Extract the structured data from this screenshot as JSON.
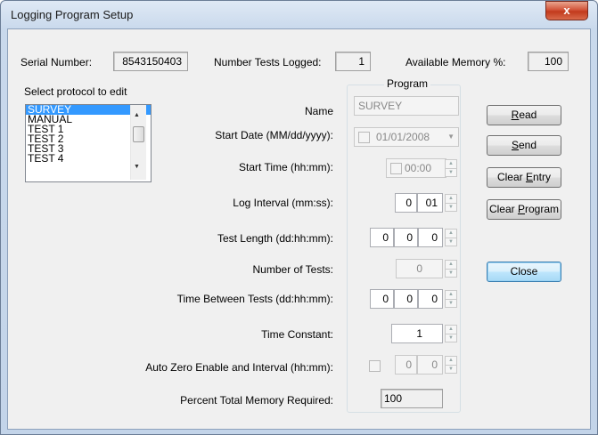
{
  "window": {
    "title": "Logging Program Setup",
    "close_glyph": "x"
  },
  "header": {
    "serial_label": "Serial Number:",
    "serial_value": "8543150403",
    "tests_label": "Number Tests Logged:",
    "tests_value": "1",
    "memory_label": "Available Memory %:",
    "memory_value": "100"
  },
  "protocol": {
    "label": "Select protocol to edit",
    "items": [
      "SURVEY",
      "MANUAL",
      "TEST 1",
      "TEST 2",
      "TEST 3",
      "TEST 4"
    ],
    "selected": "SURVEY"
  },
  "program": {
    "group_title": "Program",
    "name_label": "Name",
    "name_value": "SURVEY",
    "start_date_label": "Start Date (MM/dd/yyyy):",
    "start_date_value": "01/01/2008",
    "start_time_label": "Start Time (hh:mm):",
    "start_time_value": "00:00",
    "log_interval_label": "Log Interval (mm:ss):",
    "log_interval_mm": "0",
    "log_interval_ss": "01",
    "test_length_label": "Test Length (dd:hh:mm):",
    "test_length_dd": "0",
    "test_length_hh": "0",
    "test_length_mm": "0",
    "num_tests_label": "Number of Tests:",
    "num_tests_value": "0",
    "between_label": "Time Between Tests (dd:hh:mm):",
    "between_dd": "0",
    "between_hh": "0",
    "between_mm": "0",
    "time_constant_label": "Time Constant:",
    "time_constant_value": "1",
    "auto_zero_label": "Auto Zero Enable and  Interval (hh:mm):",
    "auto_zero_hh": "0",
    "auto_zero_mm": "0",
    "percent_label": "Percent Total Memory Required:",
    "percent_value": "100"
  },
  "buttons": {
    "read_pre": "",
    "read_u": "R",
    "read_post": "ead",
    "send_pre": "",
    "send_u": "S",
    "send_post": "end",
    "clear_entry_pre": "Clear ",
    "clear_entry_u": "E",
    "clear_entry_post": "ntry",
    "clear_program_pre": "Clear ",
    "clear_program_u": "P",
    "clear_program_post": "rogram",
    "close": "Close"
  }
}
